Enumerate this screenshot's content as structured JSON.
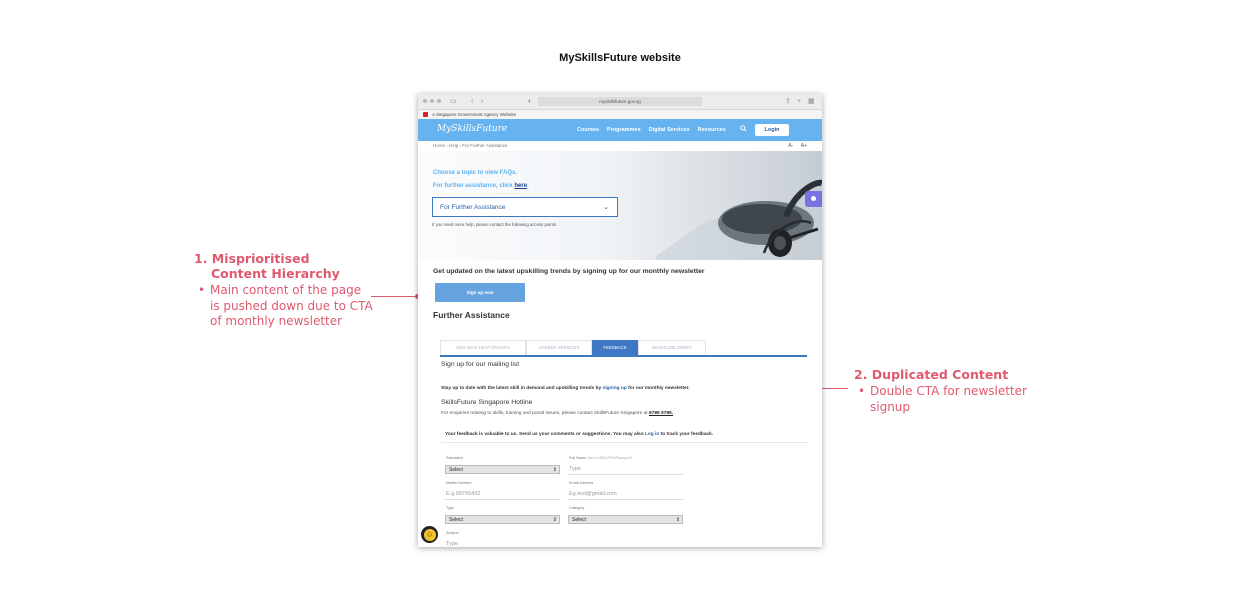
{
  "page_title": "MySkillsFuture website",
  "annotations": {
    "left": {
      "number_title_line1": "1. Misprioritised",
      "number_title_line2": "Content Hierarchy",
      "bullet": "Main content of the page is pushed down due to CTA of monthly newsletter",
      "color": "#e0596e"
    },
    "right": {
      "number_title": "2. Duplicated Content",
      "bullet": "Double CTA for newsletter signup",
      "color": "#e0596e"
    }
  },
  "browser": {
    "url": "myskillsfuture.gov.sg",
    "gov_strip": "A Singapore Government Agency Website"
  },
  "site": {
    "logo": "MySkillsFuture",
    "nav_links": [
      "Courses",
      "Programmes",
      "Digital Services",
      "Resources"
    ],
    "search_icon": "search-icon",
    "login_label": "Login",
    "breadcrumb": "Home › Help › For Further Assistance",
    "text_size": [
      "A-",
      "A+"
    ],
    "hero": {
      "line1": "Choose a topic to view FAQs.",
      "line2_prefix": "For further assistance, click ",
      "line2_link": "here",
      "line2_suffix": ".",
      "select_value": "For Further Assistance",
      "help_text": "If you need more help, please contact the following access points."
    },
    "newsletter_heading": "Get updated on the latest upskilling trends by signing up for our monthly newsletter",
    "signup_button": "Sign up now",
    "further_heading": "Further Assistance",
    "tabs": [
      {
        "label": "SNG SELF-HELP GROUPS",
        "active": false
      },
      {
        "label": "CAREER SERVICES",
        "active": false
      },
      {
        "label": "FEEDBACK",
        "active": true
      },
      {
        "label": "WHISTLEBLOWING",
        "active": false
      }
    ],
    "mailing_heading": "Sign up for our mailing list",
    "stayup_prefix": "Stay up to date with the latest skill in demand and upskilling trends by ",
    "stayup_link": "signing up",
    "stayup_suffix": " for our monthly newsletter.",
    "hotline_heading": "SkillsFuture Singapore Hotline",
    "enquiry_prefix": "For enquiries relating to skills, training and portal issues, please contact SkillsFuture Singapore at ",
    "enquiry_phone": "6785 5785.",
    "feedback_prefix": "Your feedback is valuable to us. Send us your comments or suggestions. You may also ",
    "feedback_link": "Log in",
    "feedback_suffix": " to track your feedback.",
    "form": {
      "salutation_label": "Salutation",
      "salutation_value": "Select",
      "fullname_label": "Full Name",
      "fullname_hint": "(As in NRIC/FIN/Passport)",
      "fullname_placeholder": "Type",
      "mobile_label": "Mobile Number",
      "mobile_placeholder": "E.g.98765432",
      "email_label": "Email Address",
      "email_placeholder": "Eg.test@gmail.com",
      "type_label": "Type",
      "type_value": "Select",
      "category_label": "Category",
      "category_value": "Select",
      "subject_label": "Subject",
      "subject_placeholder": "Type"
    }
  }
}
